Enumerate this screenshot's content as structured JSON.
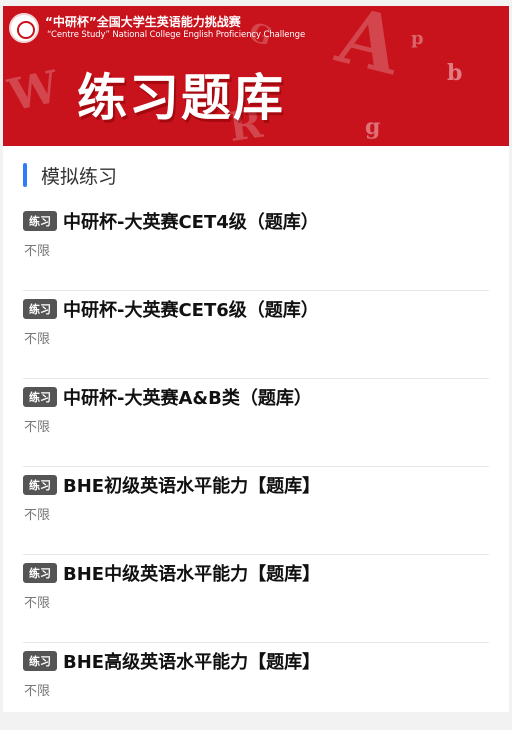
{
  "banner": {
    "title": "“中研杯”全国大学生英语能力挑战赛",
    "subtitle": "“Centre Study” National College English Proficiency Challenge",
    "big_title": "练习题库",
    "deco_letters": [
      "W",
      "G",
      "A",
      "R",
      "g",
      "b",
      "p"
    ]
  },
  "section": {
    "title": "模拟练习"
  },
  "items": [
    {
      "tag": "练习",
      "title": "中研杯-大英赛CET4级（题库）",
      "limit": "不限"
    },
    {
      "tag": "练习",
      "title": "中研杯-大英赛CET6级（题库）",
      "limit": "不限"
    },
    {
      "tag": "练习",
      "title": "中研杯-大英赛A&B类（题库）",
      "limit": "不限"
    },
    {
      "tag": "练习",
      "title": "BHE初级英语水平能力【题库】",
      "limit": "不限"
    },
    {
      "tag": "练习",
      "title": "BHE中级英语水平能力【题库】",
      "limit": "不限"
    },
    {
      "tag": "练习",
      "title": "BHE高级英语水平能力【题库】",
      "limit": "不限"
    }
  ],
  "colors": {
    "banner": "#c8121c",
    "accent": "#2f7cf6",
    "tag": "#555555"
  }
}
